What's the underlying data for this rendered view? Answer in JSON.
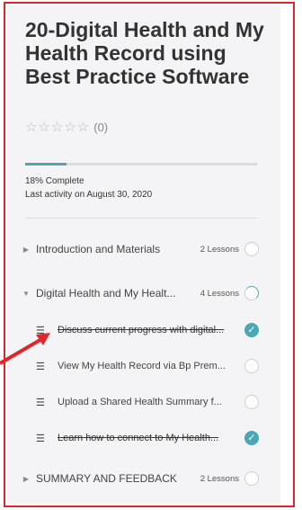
{
  "course": {
    "title": "20-Digital Health and My Health Record using Best Practice Software",
    "rating_stars": "☆☆☆☆☆",
    "rating_count": "(0)",
    "progress_percent": 18,
    "progress_text": "18% Complete",
    "last_activity": "Last activity on August 30, 2020"
  },
  "sections": [
    {
      "title": "Introduction and Materials",
      "count": "2 Lessons",
      "expanded": false,
      "status": "not-started"
    },
    {
      "title": "Digital Health and My Healt...",
      "count": "4 Lessons",
      "expanded": true,
      "status": "in-progress",
      "lessons": [
        {
          "title": "Discuss current progress with digital...",
          "completed": true
        },
        {
          "title": "View My Health Record via Bp Prem...",
          "completed": false
        },
        {
          "title": "Upload a Shared Health Summary f...",
          "completed": false
        },
        {
          "title": "Learn how to connect to My Health...",
          "completed": true
        }
      ]
    },
    {
      "title": "SUMMARY AND FEEDBACK",
      "count": "2 Lessons",
      "expanded": false,
      "status": "not-started"
    }
  ],
  "colors": {
    "accent": "#4aa7b4",
    "annotation_border": "#e0262b"
  },
  "icons": {
    "collapsed": "triangle-right-icon",
    "expanded": "triangle-down-icon",
    "lesson": "lesson-list-icon",
    "check": "check-icon"
  }
}
